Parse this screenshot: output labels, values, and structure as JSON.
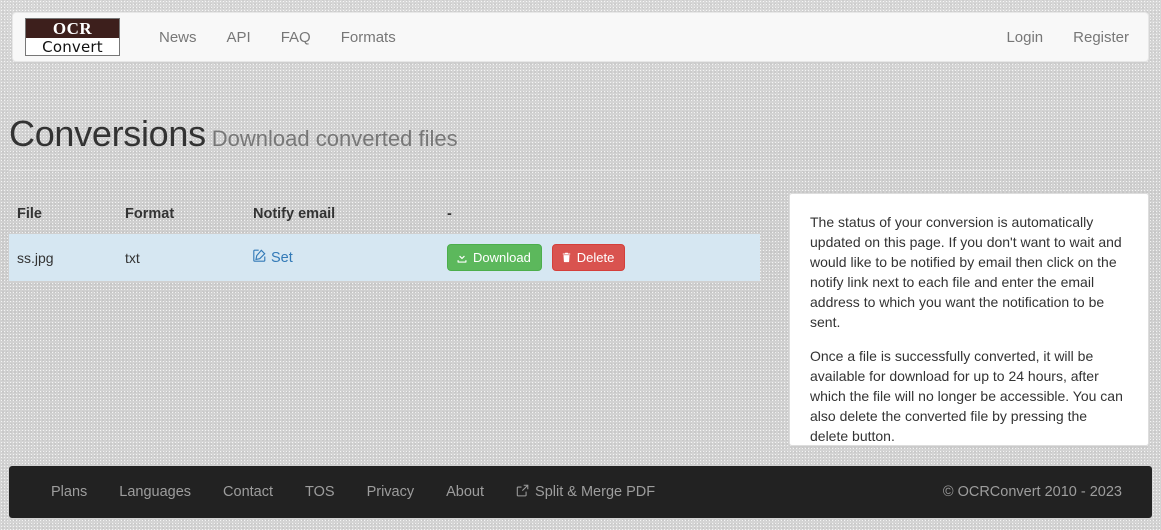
{
  "navbar": {
    "brand": {
      "top": "OCR",
      "bottom": "Convert"
    },
    "links": [
      {
        "label": "News"
      },
      {
        "label": "API"
      },
      {
        "label": "FAQ"
      },
      {
        "label": "Formats"
      }
    ],
    "right_links": [
      {
        "label": "Login"
      },
      {
        "label": "Register"
      }
    ]
  },
  "page_header": {
    "title": "Conversions",
    "subtitle": "Download converted files"
  },
  "table": {
    "headers": [
      "File",
      "Format",
      "Notify email",
      "-"
    ],
    "rows": [
      {
        "file": "ss.jpg",
        "format": "txt",
        "notify_label": "Set",
        "download_label": "Download",
        "delete_label": "Delete"
      }
    ]
  },
  "info_panel": {
    "paragraphs": [
      "The status of your conversion is automatically updated on this page. If you don't want to wait and would like to be notified by email then click on the notify link next to each file and enter the email address to which you want the notification to be sent.",
      "Once a file is successfully converted, it will be available for download for up to 24 hours, after which the file will no longer be accessible. You can also delete the converted file by pressing the delete button."
    ]
  },
  "footer": {
    "links": [
      {
        "label": "Plans"
      },
      {
        "label": "Languages"
      },
      {
        "label": "Contact"
      },
      {
        "label": "TOS"
      },
      {
        "label": "Privacy"
      },
      {
        "label": "About"
      },
      {
        "label": "Split & Merge PDF"
      }
    ],
    "copyright": "© OCRConvert 2010 - 2023"
  },
  "colors": {
    "brand_dark": "#3d1f1c",
    "navbar_bg": "#f8f8f8",
    "page_bg": "#cdcdcd",
    "row_info": "#d6e7f2",
    "link_blue": "#337ab7",
    "success_green": "#5cb85c",
    "danger_red": "#d9534f",
    "footer_bg": "#222222"
  }
}
